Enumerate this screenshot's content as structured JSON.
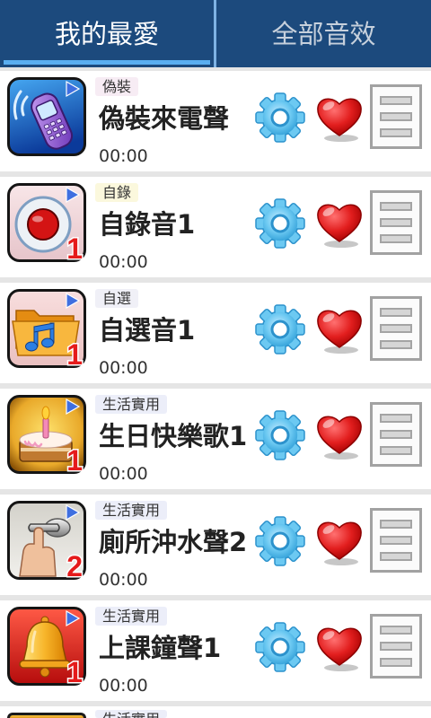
{
  "tabs": [
    {
      "label": "我的最愛",
      "selected": true
    },
    {
      "label": "全部音效",
      "selected": false
    }
  ],
  "colors": {
    "tab_bar": "#1c4a7d",
    "tab_indicator": "#5aaef0",
    "tab_text_active": "#ffffff",
    "tab_text_inactive": "#c6d0dc",
    "gear": "#6cc9f2",
    "heart": "#e21e1e",
    "badge": "#e51b1b",
    "play": "#3f6fe0"
  },
  "row_actions": {
    "settings_icon": "gear-icon",
    "favorite_icon": "heart-icon",
    "menu_icon": "list-icon",
    "play_icon": "play-icon"
  },
  "sounds": [
    {
      "category": "偽裝",
      "category_color": "#f7ecf4",
      "title": "偽裝來電聲",
      "duration": "00:00",
      "icon": "phone-call-icon"
    },
    {
      "category": "自錄",
      "category_color": "#fbf8dd",
      "title": "自錄音1",
      "duration": "00:00",
      "icon": "record-icon",
      "badge": "1"
    },
    {
      "category": "自選",
      "category_color": "#f0f0f7",
      "title": "自選音1",
      "duration": "00:00",
      "icon": "folder-music-icon",
      "badge": "1"
    },
    {
      "category": "生活實用",
      "category_color": "#eceef9",
      "title": "生日快樂歌1",
      "duration": "00:00",
      "icon": "birthday-cake-icon",
      "badge": "1"
    },
    {
      "category": "生活實用",
      "category_color": "#eceef9",
      "title": "廁所沖水聲2",
      "duration": "00:00",
      "icon": "toilet-flush-icon",
      "badge": "2"
    },
    {
      "category": "生活實用",
      "category_color": "#eceef9",
      "title": "上課鐘聲1",
      "duration": "00:00",
      "icon": "bell-icon",
      "badge": "1"
    },
    {
      "category": "生活實用",
      "category_color": "#eceef9"
    }
  ]
}
